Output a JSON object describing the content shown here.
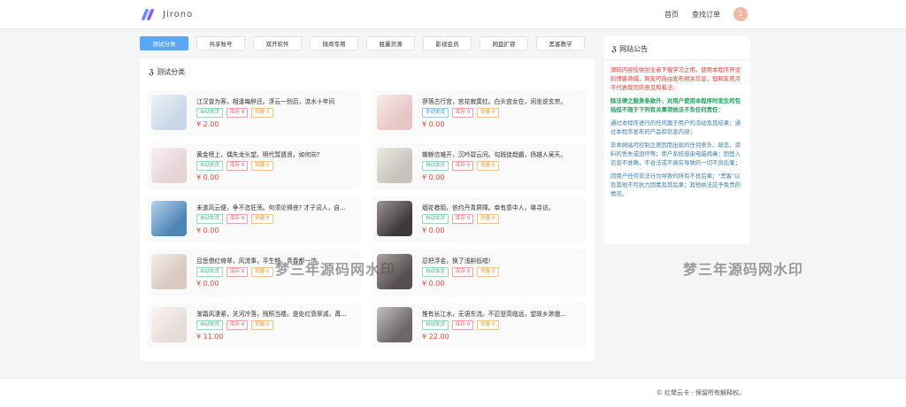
{
  "header": {
    "brand": "Jirono",
    "nav": [
      {
        "label": "首页"
      },
      {
        "label": "查找订单"
      }
    ],
    "avatar_text": "1"
  },
  "tabs": [
    {
      "label": "测试分类",
      "active": true
    },
    {
      "label": "共享账号"
    },
    {
      "label": "双开软件"
    },
    {
      "label": "微商专用"
    },
    {
      "label": "瓶囊货源"
    },
    {
      "label": "影视会员"
    },
    {
      "label": "网盘扩容"
    },
    {
      "label": "黑客教学"
    }
  ],
  "section": {
    "title": "测试分类"
  },
  "products": [
    {
      "title": "江汉曾为客，相逢每醉还。浮云一别后，流水十年间",
      "type": "自动发货",
      "stock": "库存 9",
      "sales": "销量 3",
      "price": "¥ 2.00",
      "thumb": [
        "#c9d7e8",
        "#eef2f7"
      ]
    },
    {
      "title": "寥落古行宫，宫花寂寞红。白头宫女在，闲坐说玄宗。",
      "type": "手动发货",
      "stock": "库存 0",
      "sales": "销量 0",
      "price": "¥ 0.00",
      "thumb": [
        "#e8c6c6",
        "#f7ece8"
      ]
    },
    {
      "title": "黄金榜上，偶失龙头望。明代暂遗贤，如何向?",
      "type": "自动发货",
      "stock": "库存 0",
      "sales": "销量 0",
      "price": "¥ 0.00",
      "thumb": [
        "#e7d4d7",
        "#f8f0f1"
      ]
    },
    {
      "title": "蟾蜍信难开，沉吟碧云间。勾践徒趋霸，扬雄人吴天。",
      "type": "自动发货",
      "stock": "库存 0",
      "sales": "销量 0",
      "price": "¥ 0.00",
      "thumb": [
        "#c8c2bb",
        "#ede9e4"
      ]
    },
    {
      "title": "未遂风云便，争不恣狂荡。何须论得丧? 才子词人，自...",
      "type": "自动发货",
      "stock": "库存 0",
      "sales": "销量 0",
      "price": "¥ 0.00",
      "thumb": [
        "#4f86b8",
        "#b5d2ea"
      ]
    },
    {
      "title": "烟花巷陌，依约丹青屏障。幸有意中人，堪寻访。",
      "type": "自动发货",
      "stock": "库存 0",
      "sales": "销量 0",
      "price": "¥ 0.00",
      "thumb": [
        "#3e3a3c",
        "#9b9396"
      ]
    },
    {
      "title": "且恁偎红倚翠，风流事，平生畅。青春都一饷。",
      "type": "自动发货",
      "stock": "库存 0",
      "sales": "销量 0",
      "price": "¥ 0.00",
      "thumb": [
        "#d9c9c0",
        "#f2ebe6"
      ]
    },
    {
      "title": "忍把浮名，换了浅斟低唱!",
      "type": "自动发货",
      "stock": "库存 0",
      "sales": "销量 0",
      "price": "¥ 0.00",
      "thumb": [
        "#55504f",
        "#a9a3a1"
      ]
    },
    {
      "title": "渐霜风凄紧，关河冷落，残照当楼。是处红衰翠减，苒...",
      "type": "自动发货",
      "stock": "库存 0",
      "sales": "销量 0",
      "price": "¥ 11.00",
      "thumb": [
        "#e6dcd8",
        "#f9f5f3"
      ]
    },
    {
      "title": "惟有长江水，无语东流。不忍登高临远，望故乡渺邈...",
      "type": "自动发货",
      "stock": "库存 0",
      "sales": "销量 0",
      "price": "¥ 22.00",
      "thumb": [
        "#6b6668",
        "#c4bfc0"
      ]
    }
  ],
  "notice": {
    "title": "网站公告",
    "p1": "源码内容仅供创业者下载学习之用。使用本程序开设的博客商城，网友可自由发布相关信息，但网友观点不代表我司的意见和看法。",
    "p2": "除法律之服务条款外，对用户使用本程序时发生的包括但不限于下列有关事项依法不负任何责任：",
    "p3": "通过本程序进行的任何属于用户的活动及其结果；通过本程序发布的产品和信息内容；",
    "p4": "非本网站可控制之原因而出现的任何意外、疏忽、资料的丢失或毁坏等；用户系统感染电脑病毒；因登入信息不准确，不合法或不真实导致的一切不良后果；",
    "p5": "因用户任何非法行为导致的所有不良后果；\"黑客\"以及其他不可抗力因素及其后果；其他依法应予免责的情况。"
  },
  "watermark": "梦三年源码网水印",
  "footer": {
    "copyright": "© 红鹭云卡 - 保留所有解释权。"
  },
  "colors": {
    "accent": "#5aa7f3",
    "price": "#e84c3d",
    "brand_a": "#6b8cff",
    "brand_b": "#8a5cf6"
  }
}
